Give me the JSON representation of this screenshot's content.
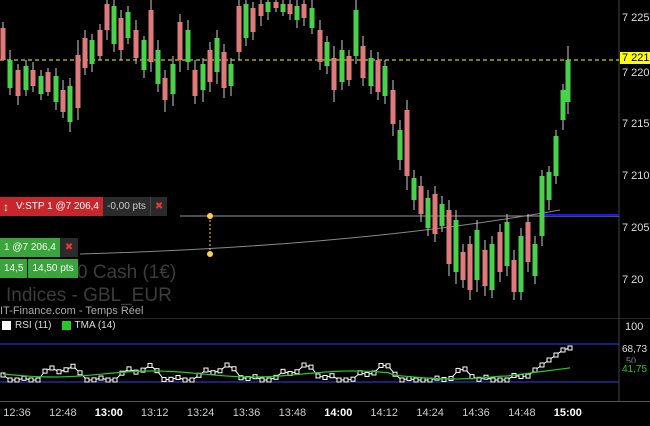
{
  "colors": {
    "bull": "#4ad14a",
    "bear": "#e07a7a",
    "stop": "#c8262b",
    "limit": "#3aa53a",
    "blue_line": "#1515ff",
    "current_line": "#ffff00",
    "rsi": "#ffffff",
    "tma": "#22cc22",
    "band": "#3a3aff"
  },
  "price_axis": {
    "labels": [
      "7 225",
      "7 221",
      "7 220",
      "7 215",
      "7 210",
      "7 205",
      "7 20"
    ],
    "current": "7 221"
  },
  "time_axis": {
    "ticks": [
      {
        "label": "12:36",
        "bold": false
      },
      {
        "label": "12:48",
        "bold": false
      },
      {
        "label": "13:00",
        "bold": true
      },
      {
        "label": "13:12",
        "bold": false
      },
      {
        "label": "13:24",
        "bold": false
      },
      {
        "label": "13:36",
        "bold": false
      },
      {
        "label": "13:48",
        "bold": false
      },
      {
        "label": "14:00",
        "bold": true
      },
      {
        "label": "14:12",
        "bold": false
      },
      {
        "label": "14:24",
        "bold": false
      },
      {
        "label": "14:36",
        "bold": false
      },
      {
        "label": "14:48",
        "bold": false
      },
      {
        "label": "15:00",
        "bold": true
      }
    ]
  },
  "orders": {
    "stop": {
      "label": "V:STP  1 @7 206,4",
      "pts": "-0,00 pts",
      "close": "✖"
    },
    "entry": {
      "label": "1 @7 206,4",
      "close": "✖"
    },
    "limit": {
      "left": "14,5",
      "right": "14,50 pts"
    }
  },
  "watermark": {
    "line1": "France 40 Cash (1€)",
    "line2": "Indices - GBL_EUR",
    "line3": "IT-Finance.com - Temps Réel"
  },
  "rsi_panel": {
    "rsi_label": "RSI (11)",
    "tma_label": "TMA (14)",
    "axis_top": "100",
    "value_rsi": "68,73",
    "value_tma": "41,75",
    "value_mid": "50"
  }
}
